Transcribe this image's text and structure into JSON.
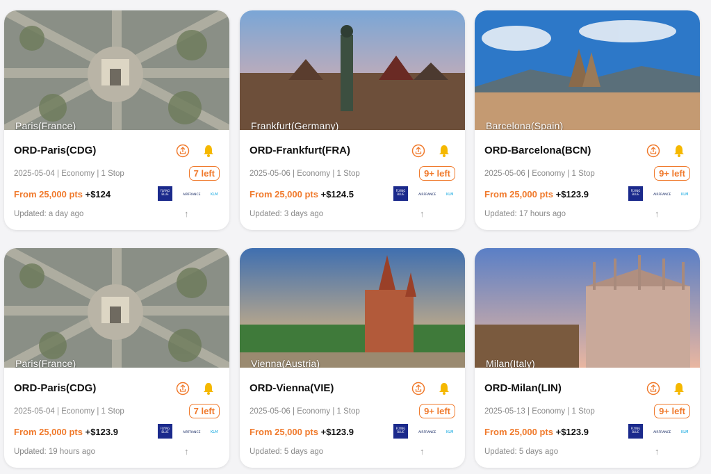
{
  "cards": [
    {
      "city": "Paris(France)",
      "route": "ORD-Paris(CDG)",
      "meta": "2025-05-04 | Economy | 1 Stop",
      "seats": "7 left",
      "pts": "From 25,000 pts",
      "usd": " +$124",
      "updated": "Updated: a day ago"
    },
    {
      "city": "Frankfurt(Germany)",
      "route": "ORD-Frankfurt(FRA)",
      "meta": "2025-05-06 | Economy | 1 Stop",
      "seats": "9+ left",
      "pts": "From 25,000 pts",
      "usd": " +$124.5",
      "updated": "Updated: 3 days ago"
    },
    {
      "city": "Barcelona(Spain)",
      "route": "ORD-Barcelona(BCN)",
      "meta": "2025-05-06 | Economy | 1 Stop",
      "seats": "9+ left",
      "pts": "From 25,000 pts",
      "usd": " +$123.9",
      "updated": "Updated: 17 hours ago"
    },
    {
      "city": "Paris(France)",
      "route": "ORD-Paris(CDG)",
      "meta": "2025-05-04 | Economy | 1 Stop",
      "seats": "7 left",
      "pts": "From 25,000 pts",
      "usd": " +$123.9",
      "updated": "Updated: 19 hours ago"
    },
    {
      "city": "Vienna(Austria)",
      "route": "ORD-Vienna(VIE)",
      "meta": "2025-05-06 | Economy | 1 Stop",
      "seats": "9+ left",
      "pts": "From 25,000 pts",
      "usd": " +$123.9",
      "updated": "Updated: 5 days ago"
    },
    {
      "city": "Milan(Italy)",
      "route": "ORD-Milan(LIN)",
      "meta": "2025-05-13 | Economy | 1 Stop",
      "seats": "9+ left",
      "pts": "From 25,000 pts",
      "usd": " +$123.9",
      "updated": "Updated: 5 days ago"
    }
  ],
  "logos": {
    "program": "FLYING BLUE FOR ME",
    "airline1": "AIRFRANCE",
    "airline2": "KLM"
  },
  "icons": {
    "share": "share-icon",
    "alert": "bell-icon",
    "sort": "arrow-up-icon"
  },
  "colors": {
    "accent": "#f07a2c",
    "bell": "#f5b800",
    "flyingblue": "#1b2a8c",
    "klm": "#00a1de"
  }
}
